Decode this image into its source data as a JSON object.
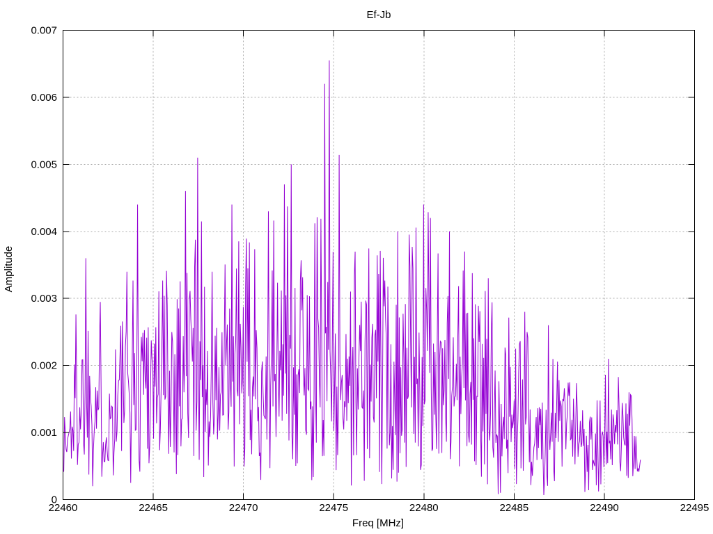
{
  "window": {
    "kind": "gnuplot-style amplitude spectrum figure",
    "background": "#ffffff"
  },
  "chart_data": {
    "type": "line",
    "subtype": "noisy-amplitude-spectrum",
    "title": "Ef-Jb",
    "xlabel": "Freq [MHz]",
    "ylabel": "Amplitude",
    "xlim": [
      22460,
      22495
    ],
    "ylim": [
      0,
      0.007
    ],
    "xticks": [
      22460,
      22465,
      22470,
      22475,
      22480,
      22485,
      22490,
      22495
    ],
    "xtick_labels": [
      "22460",
      "22465",
      "22470",
      "22475",
      "22480",
      "22485",
      "22490",
      "22495"
    ],
    "yticks": [
      0,
      0.001,
      0.002,
      0.003,
      0.004,
      0.005,
      0.006,
      0.007
    ],
    "ytick_labels": [
      "0",
      "0.001",
      "0.002",
      "0.003",
      "0.004",
      "0.005",
      "0.006",
      "0.007"
    ],
    "grid": true,
    "legend": "none",
    "colors": {
      "line": "#9400d3",
      "grid": "#aaaaaa",
      "axis": "#000000",
      "text": "#000000",
      "background": "#ffffff"
    },
    "data_range": [
      22460.0,
      22492.0
    ],
    "n_points": 760,
    "noise": {
      "distribution": "rayleigh",
      "seed": 1337,
      "sigma_over_envelope": 0.4,
      "max_clip_ratio": 1.03,
      "min_amplitude": 5e-05
    },
    "envelope_points": [
      [
        22460.0,
        0.0016
      ],
      [
        22460.3,
        0.0019
      ],
      [
        22460.7,
        0.003
      ],
      [
        22461.2,
        0.0033
      ],
      [
        22461.5,
        0.0036
      ],
      [
        22462.0,
        0.003
      ],
      [
        22462.6,
        0.0024
      ],
      [
        22463.1,
        0.0033
      ],
      [
        22463.6,
        0.0033
      ],
      [
        22464.1,
        0.0042
      ],
      [
        22464.7,
        0.004
      ],
      [
        22465.2,
        0.0037
      ],
      [
        22465.8,
        0.004
      ],
      [
        22466.3,
        0.0041
      ],
      [
        22466.9,
        0.0044
      ],
      [
        22467.4,
        0.0043
      ],
      [
        22468.0,
        0.0037
      ],
      [
        22468.6,
        0.0031
      ],
      [
        22469.1,
        0.0035
      ],
      [
        22469.6,
        0.0041
      ],
      [
        22470.1,
        0.0038
      ],
      [
        22470.7,
        0.0036
      ],
      [
        22471.2,
        0.0038
      ],
      [
        22471.8,
        0.0041
      ],
      [
        22472.3,
        0.0042
      ],
      [
        22472.9,
        0.0044
      ],
      [
        22473.4,
        0.004
      ],
      [
        22474.0,
        0.004
      ],
      [
        22474.6,
        0.005
      ],
      [
        22475.1,
        0.0046
      ],
      [
        22475.6,
        0.004
      ],
      [
        22476.2,
        0.0038
      ],
      [
        22476.8,
        0.0038
      ],
      [
        22477.3,
        0.0036
      ],
      [
        22477.9,
        0.0036
      ],
      [
        22478.4,
        0.0038
      ],
      [
        22479.0,
        0.0038
      ],
      [
        22479.5,
        0.0039
      ],
      [
        22480.0,
        0.0042
      ],
      [
        22480.6,
        0.0041
      ],
      [
        22481.1,
        0.0038
      ],
      [
        22481.7,
        0.0037
      ],
      [
        22482.2,
        0.0036
      ],
      [
        22482.8,
        0.0032
      ],
      [
        22483.3,
        0.003
      ],
      [
        22483.8,
        0.0031
      ],
      [
        22484.4,
        0.0029
      ],
      [
        22484.9,
        0.0025
      ],
      [
        22485.5,
        0.0026
      ],
      [
        22486.0,
        0.0022
      ],
      [
        22486.6,
        0.0023
      ],
      [
        22487.1,
        0.0023
      ],
      [
        22487.7,
        0.0021
      ],
      [
        22488.2,
        0.0019
      ],
      [
        22488.8,
        0.0017
      ],
      [
        22489.3,
        0.0018
      ],
      [
        22489.9,
        0.0019
      ],
      [
        22490.4,
        0.0019
      ],
      [
        22491.0,
        0.0017
      ],
      [
        22491.5,
        0.0015
      ],
      [
        22492.0,
        0.0012
      ]
    ],
    "peaks": [
      [
        22461.27,
        0.0036
      ],
      [
        22464.13,
        0.0044
      ],
      [
        22466.8,
        0.0046
      ],
      [
        22467.45,
        0.0051
      ],
      [
        22469.34,
        0.0044
      ],
      [
        22471.39,
        0.0043
      ],
      [
        22472.27,
        0.0047
      ],
      [
        22472.66,
        0.005
      ],
      [
        22474.51,
        0.0062
      ],
      [
        22474.76,
        0.00655
      ],
      [
        22475.3,
        0.00514
      ],
      [
        22478.55,
        0.004
      ],
      [
        22480.0,
        0.0044
      ],
      [
        22480.38,
        0.0042
      ],
      [
        22481.42,
        0.004
      ],
      [
        22482.27,
        0.0037
      ],
      [
        22483.58,
        0.0033
      ],
      [
        22485.59,
        0.0028
      ],
      [
        22486.9,
        0.0026
      ],
      [
        22490.25,
        0.0021
      ]
    ]
  }
}
